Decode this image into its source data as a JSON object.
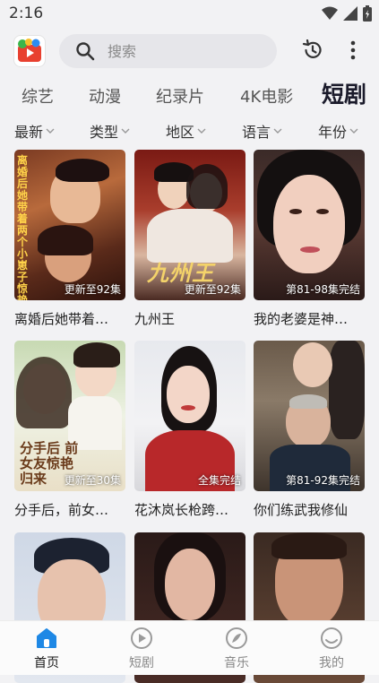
{
  "status_bar": {
    "time": "2:16"
  },
  "search": {
    "placeholder": "搜索"
  },
  "tabs": [
    {
      "label": "综艺"
    },
    {
      "label": "动漫"
    },
    {
      "label": "纪录片"
    },
    {
      "label": "4K电影"
    },
    {
      "label": "短剧",
      "active": true
    }
  ],
  "filters": [
    {
      "label": "最新"
    },
    {
      "label": "类型"
    },
    {
      "label": "地区"
    },
    {
      "label": "语言"
    },
    {
      "label": "年份"
    }
  ],
  "cards": [
    {
      "title": "离婚后她带着…",
      "badge": "更新至92集",
      "poster_text": "离婚后她带着两个小崽子惊艳全球"
    },
    {
      "title": "九州王",
      "badge": "更新至92集",
      "poster_text": "九州王"
    },
    {
      "title": "我的老婆是神…",
      "badge": "第81-98集完结"
    },
    {
      "title": "分手后，前女…",
      "badge": "更新至30集",
      "poster_text": "分手后 前女友惊艳归来"
    },
    {
      "title": "花沐岚长枪跨…",
      "badge": "全集完结"
    },
    {
      "title": "你们练武我修仙",
      "badge": "第81-92集完结"
    },
    {
      "title": "",
      "badge": ""
    },
    {
      "title": "",
      "badge": ""
    },
    {
      "title": "",
      "badge": ""
    }
  ],
  "bottom_nav": [
    {
      "label": "首页",
      "icon": "home-icon",
      "active": true
    },
    {
      "label": "短剧",
      "icon": "play-icon"
    },
    {
      "label": "音乐",
      "icon": "music-icon"
    },
    {
      "label": "我的",
      "icon": "profile-icon"
    }
  ],
  "colors": {
    "accent": "#1e88e5",
    "background": "#f2f2f4",
    "active_tab": "#1b1b2b"
  }
}
